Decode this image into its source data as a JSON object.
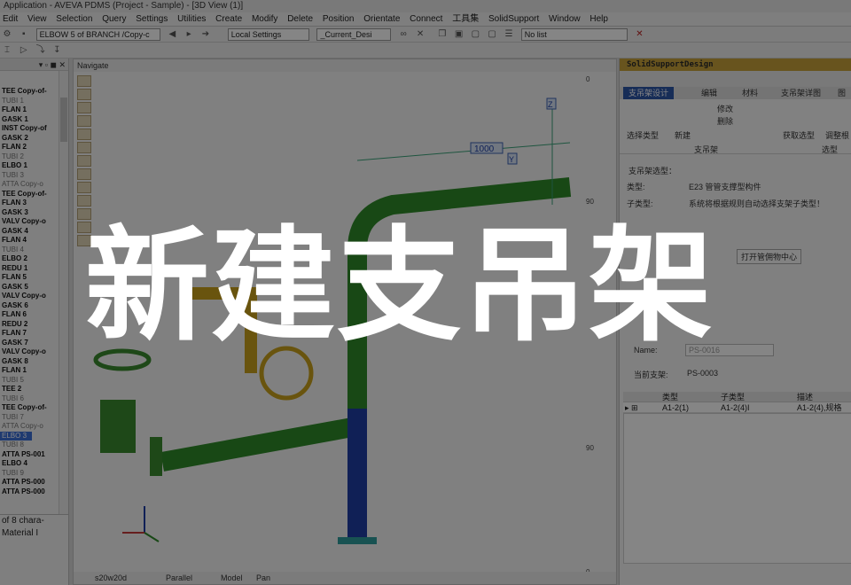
{
  "window": {
    "title": "Application -  AVEVA PDMS (Project - Sample) - [3D View (1)]"
  },
  "menu": [
    "Edit",
    "View",
    "Selection",
    "Query",
    "Settings",
    "Utilities",
    "Create",
    "Modify",
    "Delete",
    "Position",
    "Orientate",
    "Connect",
    "工具集",
    "SolidSupport",
    "Window",
    "Help"
  ],
  "toolbar": {
    "element_select": "ELBOW 5 of BRANCH /Copy-c",
    "local_settings": "Local Settings",
    "current_design": "_Current_Desi",
    "list_select": "No list"
  },
  "tree": {
    "items": [
      {
        "label": "TEE Copy-of-",
        "style": "bold"
      },
      {
        "label": "TUBI 1",
        "style": "light"
      },
      {
        "label": "FLAN 1",
        "style": "bold"
      },
      {
        "label": "GASK 1",
        "style": "bold"
      },
      {
        "label": "INST Copy-of",
        "style": "bold"
      },
      {
        "label": "GASK 2",
        "style": "bold"
      },
      {
        "label": "FLAN 2",
        "style": "bold"
      },
      {
        "label": "TUBI 2",
        "style": "light"
      },
      {
        "label": "ELBO 1",
        "style": "bold"
      },
      {
        "label": "TUBI 3",
        "style": "light"
      },
      {
        "label": "ATTA Copy-o",
        "style": "light"
      },
      {
        "label": "TEE Copy-of-",
        "style": "bold"
      },
      {
        "label": "FLAN 3",
        "style": "bold"
      },
      {
        "label": "GASK 3",
        "style": "bold"
      },
      {
        "label": "VALV Copy-o",
        "style": "bold"
      },
      {
        "label": "GASK 4",
        "style": "bold"
      },
      {
        "label": "FLAN 4",
        "style": "bold"
      },
      {
        "label": "TUBI 4",
        "style": "light"
      },
      {
        "label": "ELBO 2",
        "style": "bold"
      },
      {
        "label": "REDU 1",
        "style": "bold"
      },
      {
        "label": "FLAN 5",
        "style": "bold"
      },
      {
        "label": "GASK 5",
        "style": "bold"
      },
      {
        "label": "VALV Copy-o",
        "style": "bold"
      },
      {
        "label": "GASK 6",
        "style": "bold"
      },
      {
        "label": "FLAN 6",
        "style": "bold"
      },
      {
        "label": "REDU 2",
        "style": "bold"
      },
      {
        "label": "FLAN 7",
        "style": "bold"
      },
      {
        "label": "GASK 7",
        "style": "bold"
      },
      {
        "label": "VALV Copy-o",
        "style": "bold"
      },
      {
        "label": "GASK 8",
        "style": "bold"
      },
      {
        "label": "FLAN 1",
        "style": "bold"
      },
      {
        "label": "TUBI 5",
        "style": "light"
      },
      {
        "label": "TEE 2",
        "style": "bold"
      },
      {
        "label": "TUBI 6",
        "style": "light"
      },
      {
        "label": "TEE Copy-of-",
        "style": "bold"
      },
      {
        "label": "TUBI 7",
        "style": "light"
      },
      {
        "label": "ATTA Copy-o",
        "style": "light"
      },
      {
        "label": "ELBO 3",
        "style": "sel"
      },
      {
        "label": "TUBI 8",
        "style": "light"
      },
      {
        "label": "ATTA PS-001",
        "style": "bold"
      },
      {
        "label": "ELBO 4",
        "style": "bold"
      },
      {
        "label": "TUBI 9",
        "style": "light"
      },
      {
        "label": "ATTA PS-000",
        "style": "bold"
      },
      {
        "label": "ATTA PS-000",
        "style": "bold"
      }
    ]
  },
  "left_bottom": {
    "line1": "of 8 chara-",
    "line2": "Material I"
  },
  "viewer": {
    "header": "Navigate",
    "dimension_label": "1000",
    "axis_z": "Z",
    "axis_y": "Y",
    "status": {
      "field1": "s20w20d",
      "projection": "Parallel",
      "mode": "Model",
      "nav": "Pan"
    },
    "ruler": [
      "0",
      "90",
      "90",
      "0"
    ]
  },
  "right_panel": {
    "title": "SolidSupportDesign",
    "tabs": [
      "支吊架设计",
      "编辑",
      "材料",
      "支吊架详图",
      "图"
    ],
    "ribbon": {
      "select_type": "选择类型",
      "new": "新建",
      "modify": "修改",
      "delete": "删除",
      "group_support": "支吊架",
      "fetch": "获取选型",
      "adjust": "调整根",
      "group_right": "选型"
    },
    "section_type": "支吊架选型：",
    "type_label": "类型:",
    "type_value": "E23   管管支撑型构件",
    "subtype_label": "子类型:",
    "subtype_value": "系统将根据规则自动选择支架子类型！",
    "library_button": "打开管佣物中心",
    "name_label": "Name:",
    "name_value": "PS-0016",
    "current_label": "当前支架:",
    "current_value": "PS-0003",
    "grid": {
      "headers": [
        "类型",
        "子类型",
        "描述"
      ],
      "rows": [
        [
          "A1-2(1)",
          "A1-2(4)I",
          "A1-2(4),规格"
        ]
      ]
    }
  },
  "headline": "新建支吊架",
  "colors": {
    "pipe_green": "#2f8a2a",
    "pipe_blue": "#1f3fa6",
    "valve_yellow": "#c9a21c",
    "overlay": "#000000",
    "headline": "#ffffff"
  }
}
